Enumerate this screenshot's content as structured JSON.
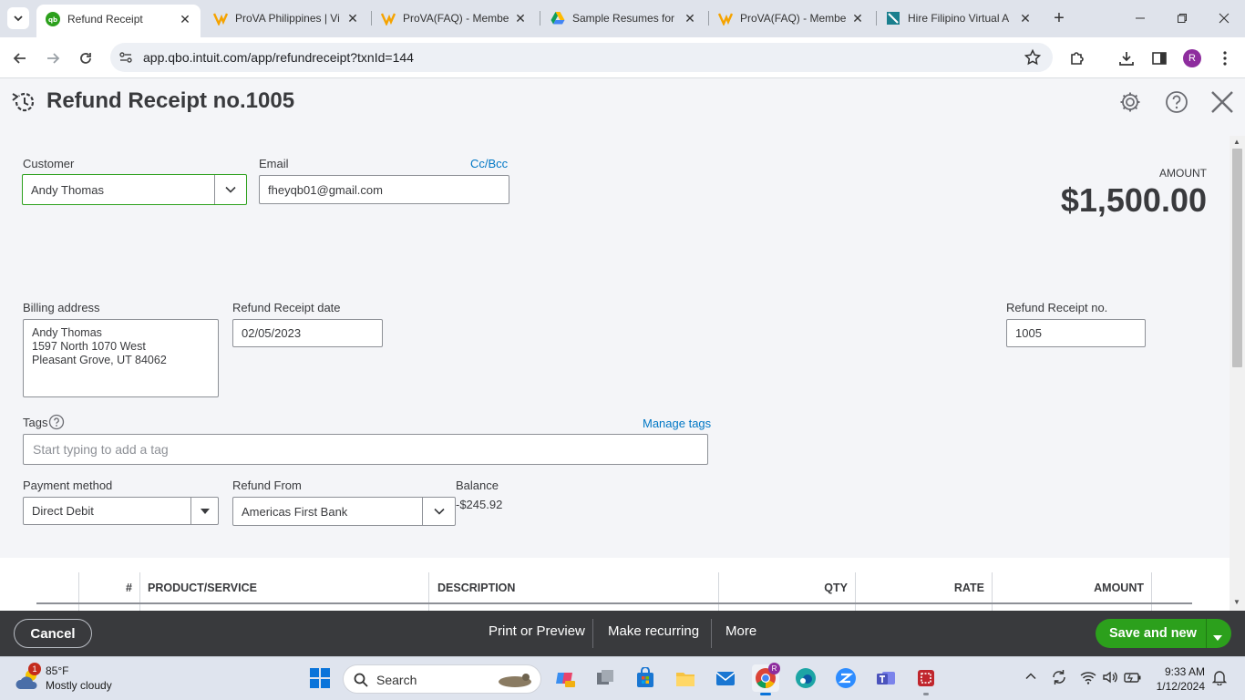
{
  "browser": {
    "tabs": [
      {
        "title": "Refund Receipt",
        "active": true
      },
      {
        "title": "ProVA Philippines | Vi",
        "active": false
      },
      {
        "title": "ProVA(FAQ) - Membe",
        "active": false
      },
      {
        "title": "Sample Resumes for",
        "active": false
      },
      {
        "title": "ProVA(FAQ) - Membe",
        "active": false
      },
      {
        "title": "Hire Filipino Virtual A",
        "active": false
      }
    ],
    "url": "app.qbo.intuit.com/app/refundreceipt?txnId=144",
    "profile_initial": "R"
  },
  "header": {
    "title": "Refund Receipt no.1005"
  },
  "form": {
    "customer_label": "Customer",
    "customer_value": "Andy Thomas",
    "email_label": "Email",
    "email_value": "fheyqb01@gmail.com",
    "ccbcc_link": "Cc/Bcc",
    "amount_label": "AMOUNT",
    "amount_value": "$1,500.00",
    "billing_label": "Billing address",
    "billing_lines": [
      "Andy Thomas",
      "1597 North 1070 West",
      "Pleasant Grove, UT  84062"
    ],
    "date_label": "Refund Receipt date",
    "date_value": "02/05/2023",
    "receipt_no_label": "Refund Receipt no.",
    "receipt_no_value": "1005",
    "tags_label": "Tags",
    "manage_tags_link": "Manage tags",
    "tags_placeholder": "Start typing to add a tag",
    "payment_method_label": "Payment method",
    "payment_method_value": "Direct Debit",
    "refund_from_label": "Refund From",
    "refund_from_value": "Americas First Bank",
    "balance_label": "Balance",
    "balance_value": "-$245.92"
  },
  "table": {
    "headers": [
      "#",
      "PRODUCT/SERVICE",
      "DESCRIPTION",
      "QTY",
      "RATE",
      "AMOUNT"
    ]
  },
  "footer": {
    "cancel": "Cancel",
    "print_preview": "Print or Preview",
    "make_recurring": "Make recurring",
    "more": "More",
    "save_new": "Save and new"
  },
  "taskbar": {
    "weather_badge": "1",
    "temperature": "85°F",
    "condition": "Mostly cloudy",
    "search_placeholder": "Search",
    "time": "9:33 AM",
    "date": "1/12/2024"
  },
  "colors": {
    "accent_green": "#2ca01c",
    "link_blue": "#0077c5",
    "footer_bg": "#393a3d"
  }
}
